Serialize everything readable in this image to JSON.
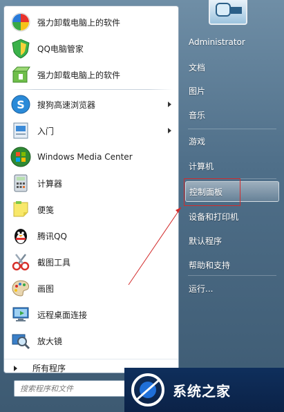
{
  "programs": [
    {
      "label": "强力卸载电脑上的软件",
      "icon": "pinwheel-icon",
      "arrow": false
    },
    {
      "label": "QQ电脑管家",
      "icon": "shield-icon",
      "arrow": false
    },
    {
      "label": "强力卸载电脑上的软件",
      "icon": "uninstall-box-icon",
      "arrow": false
    },
    {
      "label": "搜狗高速浏览器",
      "icon": "sogou-browser-icon",
      "arrow": true
    },
    {
      "label": "入门",
      "icon": "getting-started-icon",
      "arrow": true
    },
    {
      "label": "Windows Media Center",
      "icon": "windows-logo-icon",
      "arrow": false
    },
    {
      "label": "计算器",
      "icon": "calculator-icon",
      "arrow": false
    },
    {
      "label": "便笺",
      "icon": "sticky-note-icon",
      "arrow": false
    },
    {
      "label": "腾讯QQ",
      "icon": "penguin-icon",
      "arrow": false
    },
    {
      "label": "截图工具",
      "icon": "scissors-icon",
      "arrow": false
    },
    {
      "label": "画图",
      "icon": "palette-icon",
      "arrow": false
    },
    {
      "label": "远程桌面连接",
      "icon": "remote-desktop-icon",
      "arrow": false
    },
    {
      "label": "放大镜",
      "icon": "magnifier-icon",
      "arrow": false
    }
  ],
  "all_programs_label": "所有程序",
  "search": {
    "placeholder": "搜索程序和文件"
  },
  "right_menu": {
    "user_name": "Administrator",
    "documents": "文档",
    "pictures": "图片",
    "music": "音乐",
    "games": "游戏",
    "computer": "计算机",
    "control_panel": "控制面板",
    "devices_printers": "设备和打印机",
    "default_programs": "默认程序",
    "help_support": "帮助和支持",
    "run": "运行..."
  },
  "watermark": {
    "text": "系统之家"
  },
  "colors": {
    "annotation": "#d22b2b",
    "highlight": "#ffffff"
  }
}
